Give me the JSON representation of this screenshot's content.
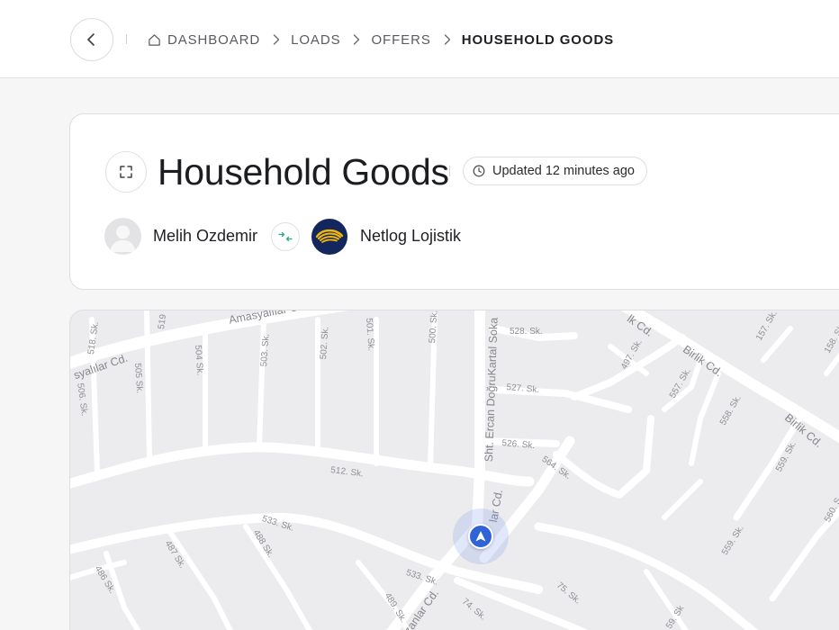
{
  "breadcrumb": {
    "items": [
      {
        "label": "DASHBOARD",
        "icon": "home-icon"
      },
      {
        "label": "LOADS"
      },
      {
        "label": "OFFERS"
      },
      {
        "label": "HOUSEHOLD GOODS"
      }
    ]
  },
  "header": {
    "title": "Household Goods",
    "updated": "Updated 12 minutes ago"
  },
  "parties": {
    "person_name": "Melih Ozdemir",
    "company_name": "Netlog Lojistik"
  },
  "map": {
    "streets": [
      "Amasyalılar Cd.",
      "syalılar Cd.",
      "518. Sk.",
      "519",
      "506. Sk.",
      "505 Sk.",
      "504 Sk.",
      "503. Sk.",
      "502. Sk.",
      "501. Sk.",
      "500. Sk.",
      "528. Sk.",
      "527. Sk.",
      "526. Sk.",
      "512. Sk.",
      "Sht. Ercan DoğruKartal Soka",
      "lar Cd.",
      "564. Sk.",
      "497. Sk.",
      "557. Sk.",
      "558. Sk.",
      "Birlik Cd.",
      "Birlik Cd.",
      "lk Cd.",
      "157. Sk.",
      "158. Sk",
      "559. Sk.",
      "560. S",
      "533. Sk.",
      "533. Sk.",
      "487 Sk.",
      "488 Sk.",
      "486 Sk.",
      "489. Sk.",
      "zanlar Cd.",
      "74. Sk.",
      "75. Sk.",
      "559. Sk.",
      "59. Sk"
    ]
  },
  "colors": {
    "accent": "#2f63d6",
    "logo_bg": "#14265e",
    "logo_stripes": "#f2b705",
    "swap_icon": "#2fa88a"
  }
}
